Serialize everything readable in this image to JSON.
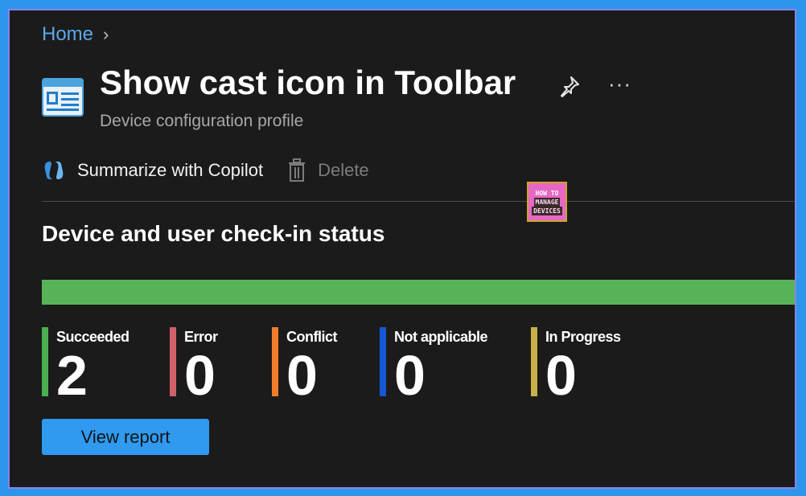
{
  "breadcrumb": {
    "home": "Home"
  },
  "header": {
    "title": "Show cast icon in Toolbar",
    "subtitle": "Device configuration profile"
  },
  "toolbar": {
    "copilot_label": "Summarize with Copilot",
    "delete_label": "Delete"
  },
  "logo": {
    "line1": "HOW TO",
    "line2": "MANAGE",
    "line3": "DEVICES"
  },
  "section": {
    "title": "Device and user check-in status"
  },
  "stats": [
    {
      "label": "Succeeded",
      "value": "2",
      "color": "#4caf50"
    },
    {
      "label": "Error",
      "value": "0",
      "color": "#d0606a"
    },
    {
      "label": "Conflict",
      "value": "0",
      "color": "#f07c2c"
    },
    {
      "label": "Not applicable",
      "value": "0",
      "color": "#1558d6"
    },
    {
      "label": "In Progress",
      "value": "0",
      "color": "#c9b04a"
    }
  ],
  "status_bar": {
    "succeeded_fraction": 1.0,
    "color": "#58b258"
  },
  "actions": {
    "view_report_label": "View report"
  }
}
